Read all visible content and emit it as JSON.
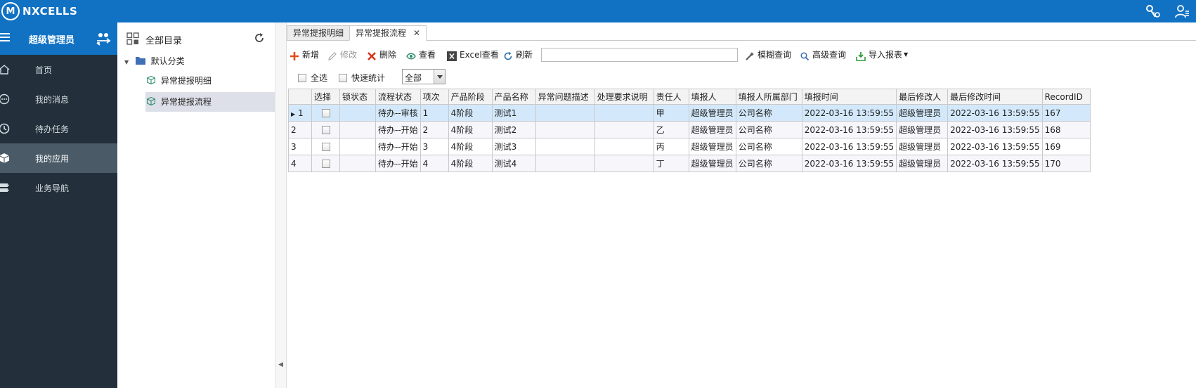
{
  "app": {
    "logo_mark": "M",
    "logo_text": "NXCELLS",
    "brand_color": "#1172c4"
  },
  "header": {
    "icons": [
      "key-gear-icon",
      "user-settings-icon"
    ]
  },
  "nav": {
    "user_name": "超级管理员",
    "items": [
      {
        "label": "首页",
        "icon": "home-icon",
        "active": false
      },
      {
        "label": "我的消息",
        "icon": "message-icon",
        "active": false
      },
      {
        "label": "待办任务",
        "icon": "clock-icon",
        "active": false
      },
      {
        "label": "我的应用",
        "icon": "cube-icon",
        "active": true
      },
      {
        "label": "业务导航",
        "icon": "navigation-icon",
        "active": false
      }
    ]
  },
  "tree": {
    "title": "全部目录",
    "root": "默认分类",
    "children": [
      "异常提报明细",
      "异常提报流程"
    ],
    "selected_index": 1
  },
  "tabs": [
    {
      "label": "异常提报明细",
      "active": false
    },
    {
      "label": "异常提报流程",
      "active": true,
      "close": "✕"
    }
  ],
  "toolbar": {
    "add": "新增",
    "edit": "修改",
    "delete": "删除",
    "view": "查看",
    "excel_view": "Excel查看",
    "refresh": "刷新",
    "search_value": "",
    "fuzzy_query": "模糊查询",
    "advanced_query": "高级查询",
    "import_report": "导入报表"
  },
  "filter": {
    "select_all": "全选",
    "quick_stats": "快速统计",
    "scope_value": "全部"
  },
  "grid": {
    "columns": [
      "",
      "选择",
      "锁状态",
      "流程状态",
      "项次",
      "产品阶段",
      "产品名称",
      "异常问题描述",
      "处理要求说明",
      "责任人",
      "填报人",
      "填报人所属部门",
      "填报时间",
      "最后修改人",
      "最后修改时间",
      "RecordID"
    ],
    "rows": [
      {
        "rownum": "1",
        "lock": "",
        "state": "待办--审核",
        "item": "1",
        "stage": "4阶段",
        "name": "测试1",
        "desc": "",
        "req": "",
        "owner": "甲",
        "reporter": "超级管理员",
        "dept": "公司名称",
        "report_time": "2022-03-16 13:59:55",
        "modifier": "超级管理员",
        "modify_time": "2022-03-16 13:59:55",
        "record_id": "167"
      },
      {
        "rownum": "2",
        "lock": "",
        "state": "待办--开始",
        "item": "2",
        "stage": "4阶段",
        "name": "测试2",
        "desc": "",
        "req": "",
        "owner": "乙",
        "reporter": "超级管理员",
        "dept": "公司名称",
        "report_time": "2022-03-16 13:59:55",
        "modifier": "超级管理员",
        "modify_time": "2022-03-16 13:59:55",
        "record_id": "168"
      },
      {
        "rownum": "3",
        "lock": "",
        "state": "待办--开始",
        "item": "3",
        "stage": "4阶段",
        "name": "测试3",
        "desc": "",
        "req": "",
        "owner": "丙",
        "reporter": "超级管理员",
        "dept": "公司名称",
        "report_time": "2022-03-16 13:59:55",
        "modifier": "超级管理员",
        "modify_time": "2022-03-16 13:59:55",
        "record_id": "169"
      },
      {
        "rownum": "4",
        "lock": "",
        "state": "待办--开始",
        "item": "4",
        "stage": "4阶段",
        "name": "测试4",
        "desc": "",
        "req": "",
        "owner": "丁",
        "reporter": "超级管理员",
        "dept": "公司名称",
        "report_time": "2022-03-16 13:59:55",
        "modifier": "超级管理员",
        "modify_time": "2022-03-16 13:59:55",
        "record_id": "170"
      }
    ]
  }
}
